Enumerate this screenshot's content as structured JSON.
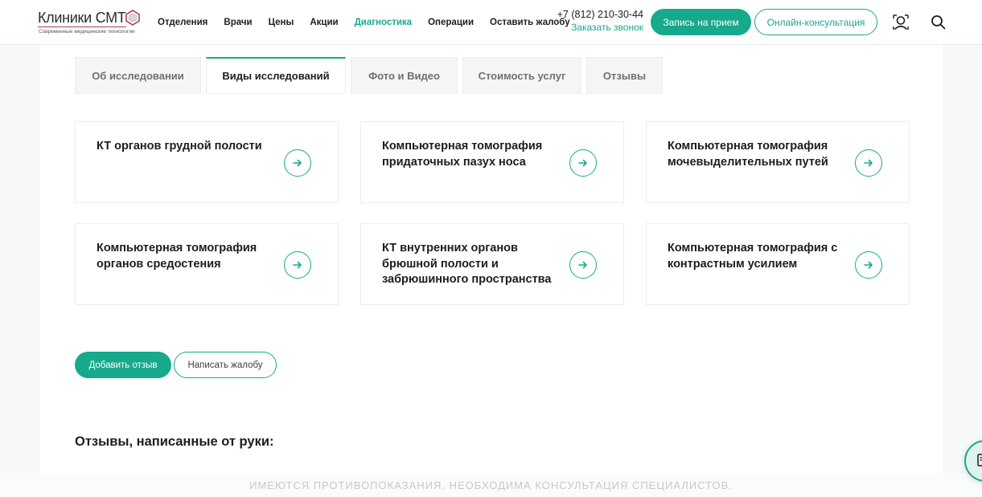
{
  "header": {
    "logo": {
      "title": "Клиники СМТ",
      "subtitle": "Современные медицинские технологии"
    },
    "nav": [
      {
        "label": "Отделения",
        "active": false
      },
      {
        "label": "Врачи",
        "active": false
      },
      {
        "label": "Цены",
        "active": false
      },
      {
        "label": "Акции",
        "active": false
      },
      {
        "label": "Диагностика",
        "active": true
      },
      {
        "label": "Операции",
        "active": false
      },
      {
        "label": "Оставить жалобу",
        "active": false
      }
    ],
    "phone": "+7 (812) 210-30-44",
    "callback": "Заказать звонок",
    "appointment_button": "Запись на прием",
    "online_button": "Онлайн-консультация",
    "icons": {
      "user": "user-icon",
      "search": "search-icon"
    }
  },
  "tabs": [
    {
      "label": "Об исследовании",
      "active": false
    },
    {
      "label": "Виды исследований",
      "active": true
    },
    {
      "label": "Фото и Видео",
      "active": false
    },
    {
      "label": "Стоимость услуг",
      "active": false
    },
    {
      "label": "Отзывы",
      "active": false
    }
  ],
  "cards": [
    {
      "title": "КТ органов грудной полости"
    },
    {
      "title": "Компьютерная томография придаточных пазух носа"
    },
    {
      "title": "Компьютерная томография мочевыделительных путей"
    },
    {
      "title": "Компьютерная томография органов средостения"
    },
    {
      "title": "КТ внутренних органов брюшной полости и забрюшинного пространства"
    },
    {
      "title": "Компьютерная томография с контрастным усилием"
    }
  ],
  "actions": {
    "add_review": "Добавить отзыв",
    "write_complaint": "Написать жалобу"
  },
  "section_title": "Отзывы, написанные от руки:",
  "footer_notice": "ИМЕЮТСЯ ПРОТИВОПОКАЗАНИЯ. НЕОБХОДИМА КОНСУЛЬТАЦИЯ СПЕЦИАЛИСТОВ.",
  "colors": {
    "accent": "#16a98b",
    "text": "#1d1d1f",
    "muted": "#6e7173"
  }
}
